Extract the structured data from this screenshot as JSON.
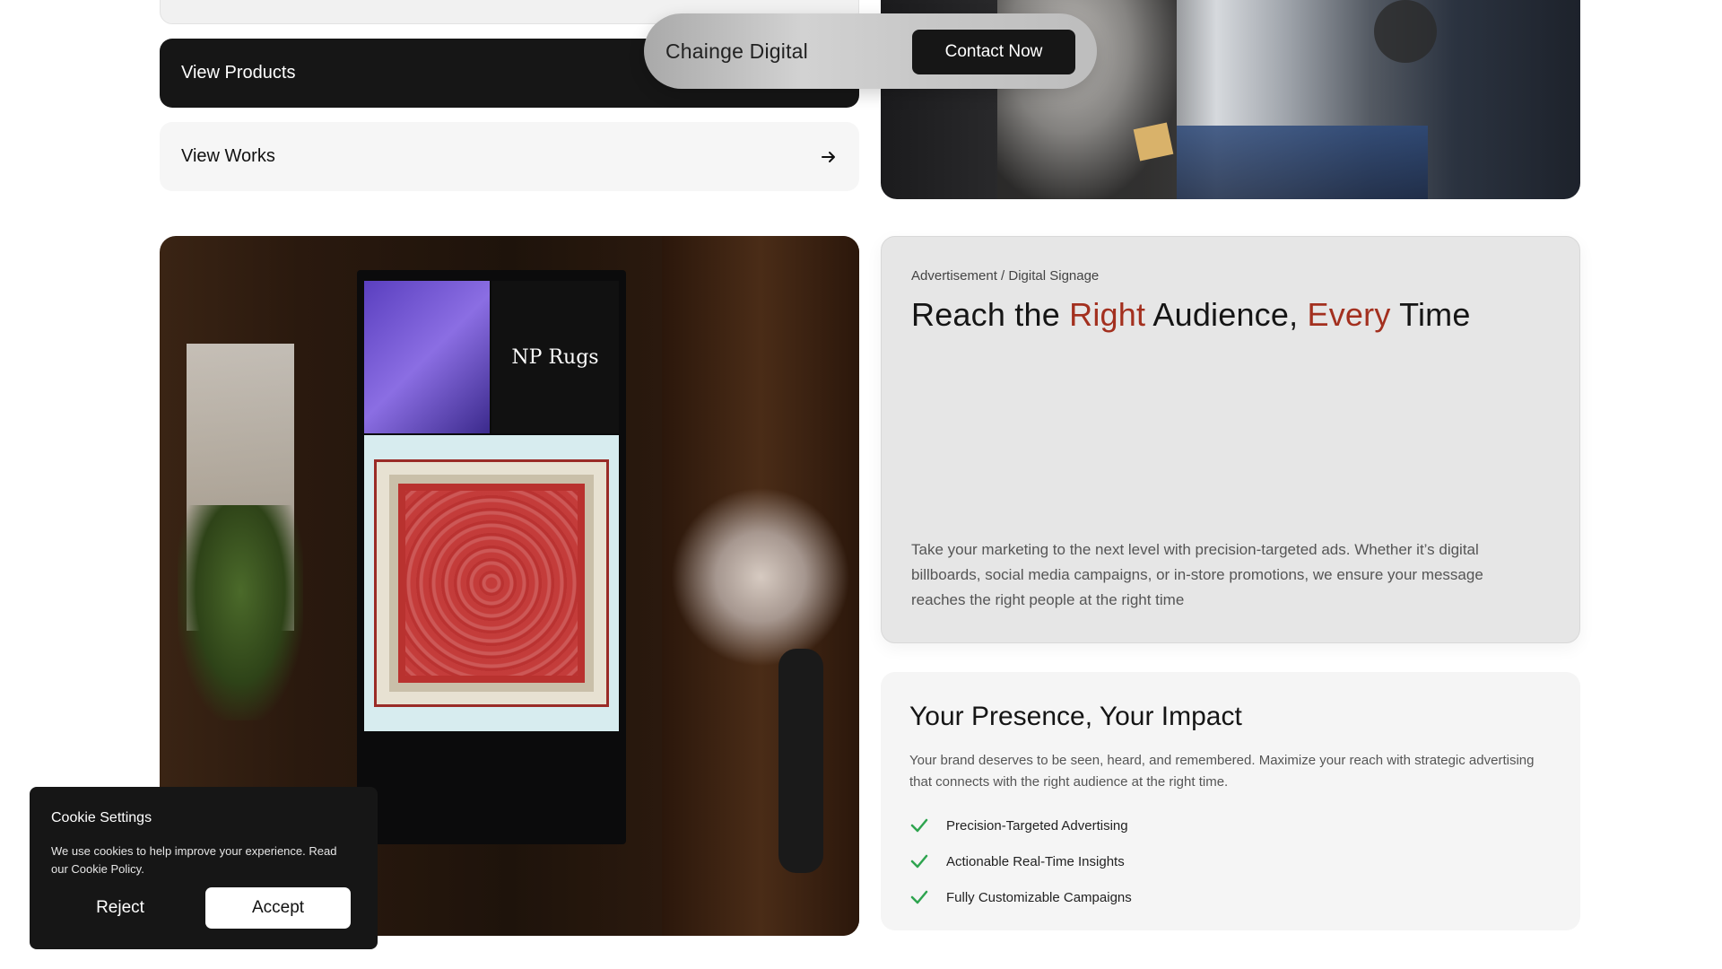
{
  "nav": {
    "brand": "Chainge Digital",
    "contact_label": "Contact Now"
  },
  "actions": {
    "view_products": "View Products",
    "view_works": "View Works",
    "arrow_icon": "arrow-right-icon"
  },
  "signage_image": {
    "brand_text": "NP Rugs"
  },
  "advertisement": {
    "breadcrumb": "Advertisement / Digital Signage",
    "title_part1": "Reach the ",
    "title_accent1": "Right",
    "title_part2": " Audience, ",
    "title_accent2": "Every",
    "title_part3": " Time",
    "body": "Take your marketing to the next level with precision-targeted ads. Whether it’s digital billboards, social media campaigns, or in-store promotions, we ensure your message reaches the right people at the right time",
    "accent_color": "#a3301f"
  },
  "presence": {
    "title": "Your Presence, Your Impact",
    "body": "Your brand deserves to be seen, heard, and remembered. Maximize your reach with strategic advertising that connects with the right audience at the right time.",
    "items": [
      {
        "label": "Precision-Targeted Advertising",
        "icon": "check-icon"
      },
      {
        "label": "Actionable Real-Time Insights",
        "icon": "check-icon"
      },
      {
        "label": "Fully Customizable Campaigns",
        "icon": "check-icon"
      }
    ],
    "check_color": "#2ea44f"
  },
  "cookie": {
    "title": "Cookie Settings",
    "text": "We use cookies to help improve your experience. Read our Cookie Policy.",
    "reject_label": "Reject",
    "accept_label": "Accept"
  }
}
